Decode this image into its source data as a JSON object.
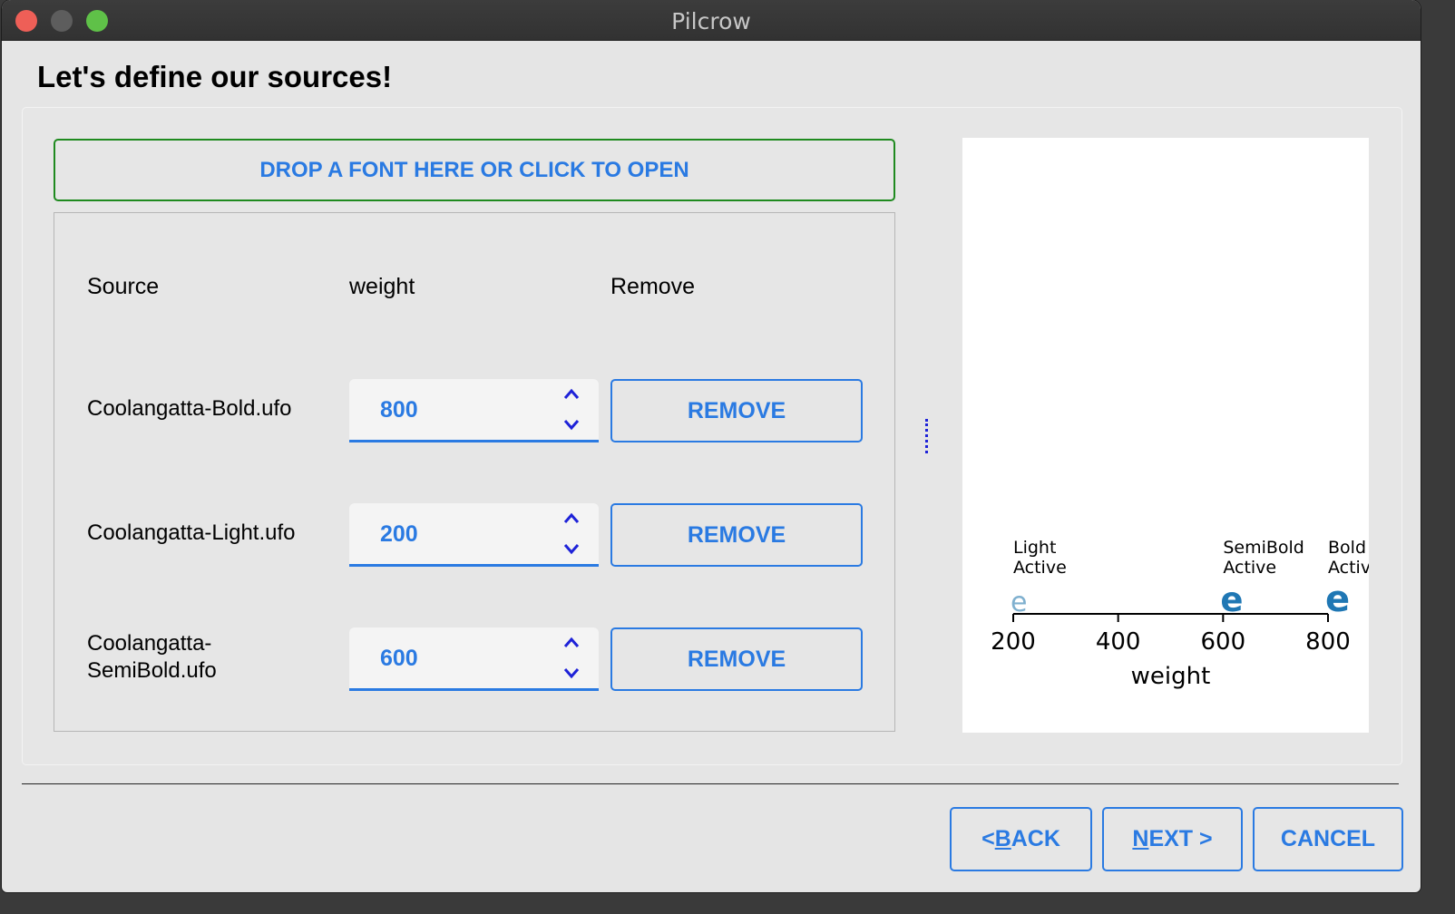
{
  "window": {
    "title": "Pilcrow"
  },
  "page": {
    "title": "Let's define our sources!"
  },
  "drop_zone": {
    "label": "DROP A FONT HERE OR CLICK TO OPEN"
  },
  "table": {
    "headers": {
      "source": "Source",
      "axis": "weight",
      "remove": "Remove"
    },
    "rows": [
      {
        "source_line1": "Coolangatta-Bold.ufo",
        "source_line2": "",
        "value": "800",
        "remove_label": "REMOVE"
      },
      {
        "source_line1": "Coolangatta-Light.ufo",
        "source_line2": "",
        "value": "200",
        "remove_label": "REMOVE"
      },
      {
        "source_line1": "Coolangatta-",
        "source_line2": "SemiBold.ufo",
        "value": "600",
        "remove_label": "REMOVE"
      }
    ]
  },
  "chart_data": {
    "type": "scatter",
    "xlabel": "weight",
    "xlim": [
      200,
      800
    ],
    "ticks": [
      "200",
      "400",
      "600",
      "800"
    ],
    "points": [
      {
        "x": 200,
        "glyph": "e",
        "name": "Light",
        "status": "Active",
        "style": "light",
        "color": "#7fb0cf"
      },
      {
        "x": 600,
        "glyph": "e",
        "name": "SemiBold",
        "status": "Active",
        "style": "semibold",
        "color": "#1f77b4"
      },
      {
        "x": 800,
        "glyph": "e",
        "name": "Bold",
        "status": "Activ",
        "style": "bold",
        "color": "#1f77b4"
      }
    ]
  },
  "footer": {
    "back_prefix": "< ",
    "back_key": "B",
    "back_rest": "ACK",
    "next_key": "N",
    "next_rest": "EXT >",
    "cancel": "CANCEL"
  },
  "colors": {
    "accent": "#2a7ae2",
    "drop_border": "#1f8a1f",
    "splitter": "#1e22d8"
  }
}
